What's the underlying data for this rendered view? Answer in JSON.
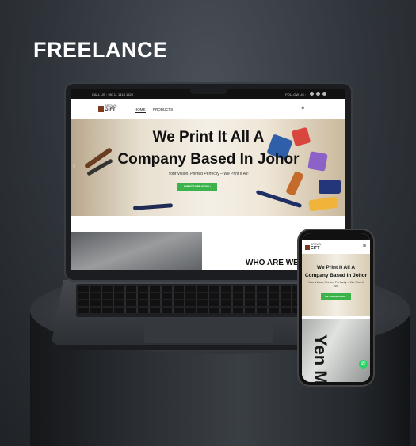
{
  "headline": "FREELANCE",
  "site": {
    "topbar_left": "CALL US : +60 11 1414 1529",
    "topbar_right": "FOLLOW US :",
    "logo_line1": "BROWN",
    "logo_line2": "GIFT",
    "nav": [
      "HOME",
      "PRODUCTS"
    ],
    "hero_title_1": "We Print It All A",
    "hero_title_2": "Company Based In Johor",
    "hero_subtitle": "Your Vision, Printed Perfectly – We Print It All!",
    "hero_button": "WHATSAPP NOW ›",
    "section_title": "WHO ARE WE?"
  },
  "phone": {
    "hero_title_1": "We Print It All A",
    "hero_title_2": "Company Based In Johor",
    "hero_subtitle": "Your Vision, Printed Perfectly – We Print It All!",
    "hero_button": "WHATSAPP NOW ›",
    "image_text": "Yen Mi"
  },
  "icons": {
    "search": "search-icon",
    "menu": "hamburger-menu-icon",
    "whatsapp": "whatsapp-icon"
  }
}
